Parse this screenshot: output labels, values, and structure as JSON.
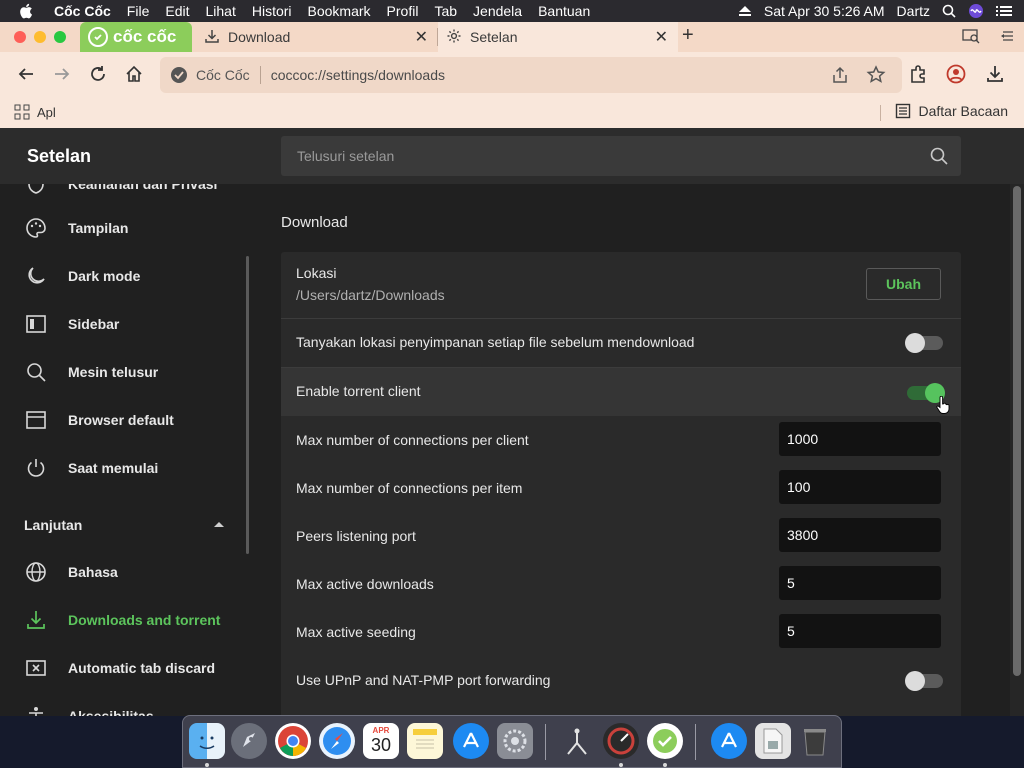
{
  "menubar": {
    "app_name": "Cốc Cốc",
    "items": [
      "File",
      "Edit",
      "Lihat",
      "Histori",
      "Bookmark",
      "Profil",
      "Tab",
      "Jendela",
      "Bantuan"
    ],
    "datetime": "Sat Apr 30  5:26 AM",
    "user": "Dartz"
  },
  "tabs": {
    "logo_text": "cốc cốc",
    "tab1_title": "Download",
    "tab2_title": "Setelan"
  },
  "toolbar": {
    "site_name": "Cốc Cốc",
    "url": "coccoc://settings/downloads"
  },
  "bookmarks": {
    "apps_label": "Apl",
    "reading_list": "Daftar Bacaan"
  },
  "settings": {
    "title": "Setelan",
    "search_placeholder": "Telusuri setelan"
  },
  "sidebar": {
    "partial_top": "Keamanan dan Privasi",
    "items": [
      {
        "label": "Tampilan",
        "icon": "palette-icon"
      },
      {
        "label": "Dark mode",
        "icon": "moon-icon"
      },
      {
        "label": "Sidebar",
        "icon": "sidebar-icon"
      },
      {
        "label": "Mesin telusur",
        "icon": "search-icon"
      },
      {
        "label": "Browser default",
        "icon": "browser-icon"
      },
      {
        "label": "Saat memulai",
        "icon": "power-icon"
      }
    ],
    "section": "Lanjutan",
    "advanced": [
      {
        "label": "Bahasa",
        "icon": "globe-icon"
      },
      {
        "label": "Downloads and torrent",
        "icon": "download-icon",
        "active": true
      },
      {
        "label": "Automatic tab discard",
        "icon": "tab-discard-icon"
      }
    ],
    "partial_bottom": "Aksesibilitas"
  },
  "main": {
    "section_title": "Download",
    "location_label": "Lokasi",
    "location_path": "/Users/dartz/Downloads",
    "change_button": "Ubah",
    "ask_location_label": "Tanyakan lokasi penyimpanan setiap file sebelum mendownload",
    "ask_location_on": false,
    "torrent_label": "Enable torrent client",
    "torrent_on": true,
    "max_conn_client_label": "Max number of connections per client",
    "max_conn_client_value": "1000",
    "max_conn_item_label": "Max number of connections per item",
    "max_conn_item_value": "100",
    "peers_port_label": "Peers listening port",
    "peers_port_value": "3800",
    "max_active_downloads_label": "Max active downloads",
    "max_active_downloads_value": "5",
    "max_active_seeding_label": "Max active seeding",
    "max_active_seeding_value": "5",
    "upnp_label": "Use UPnP and NAT-PMP port forwarding",
    "upnp_on": false
  },
  "colors": {
    "accent_green": "#5cc45c",
    "tab_bg": "#f4d9c7",
    "toolbar_bg": "#f9e7db",
    "settings_bg": "#202020"
  },
  "dock": {
    "apps": [
      "finder-icon",
      "launchpad-icon",
      "chrome-icon",
      "safari-icon",
      "calendar-icon",
      "notes-icon",
      "app-store-icon",
      "system-preferences-icon",
      "network-utility-icon",
      "instruments-icon",
      "coccoc-icon",
      "xcode-installer-icon",
      "preview-icon",
      "trash-icon"
    ],
    "calendar_month": "APR",
    "calendar_day": "30"
  }
}
